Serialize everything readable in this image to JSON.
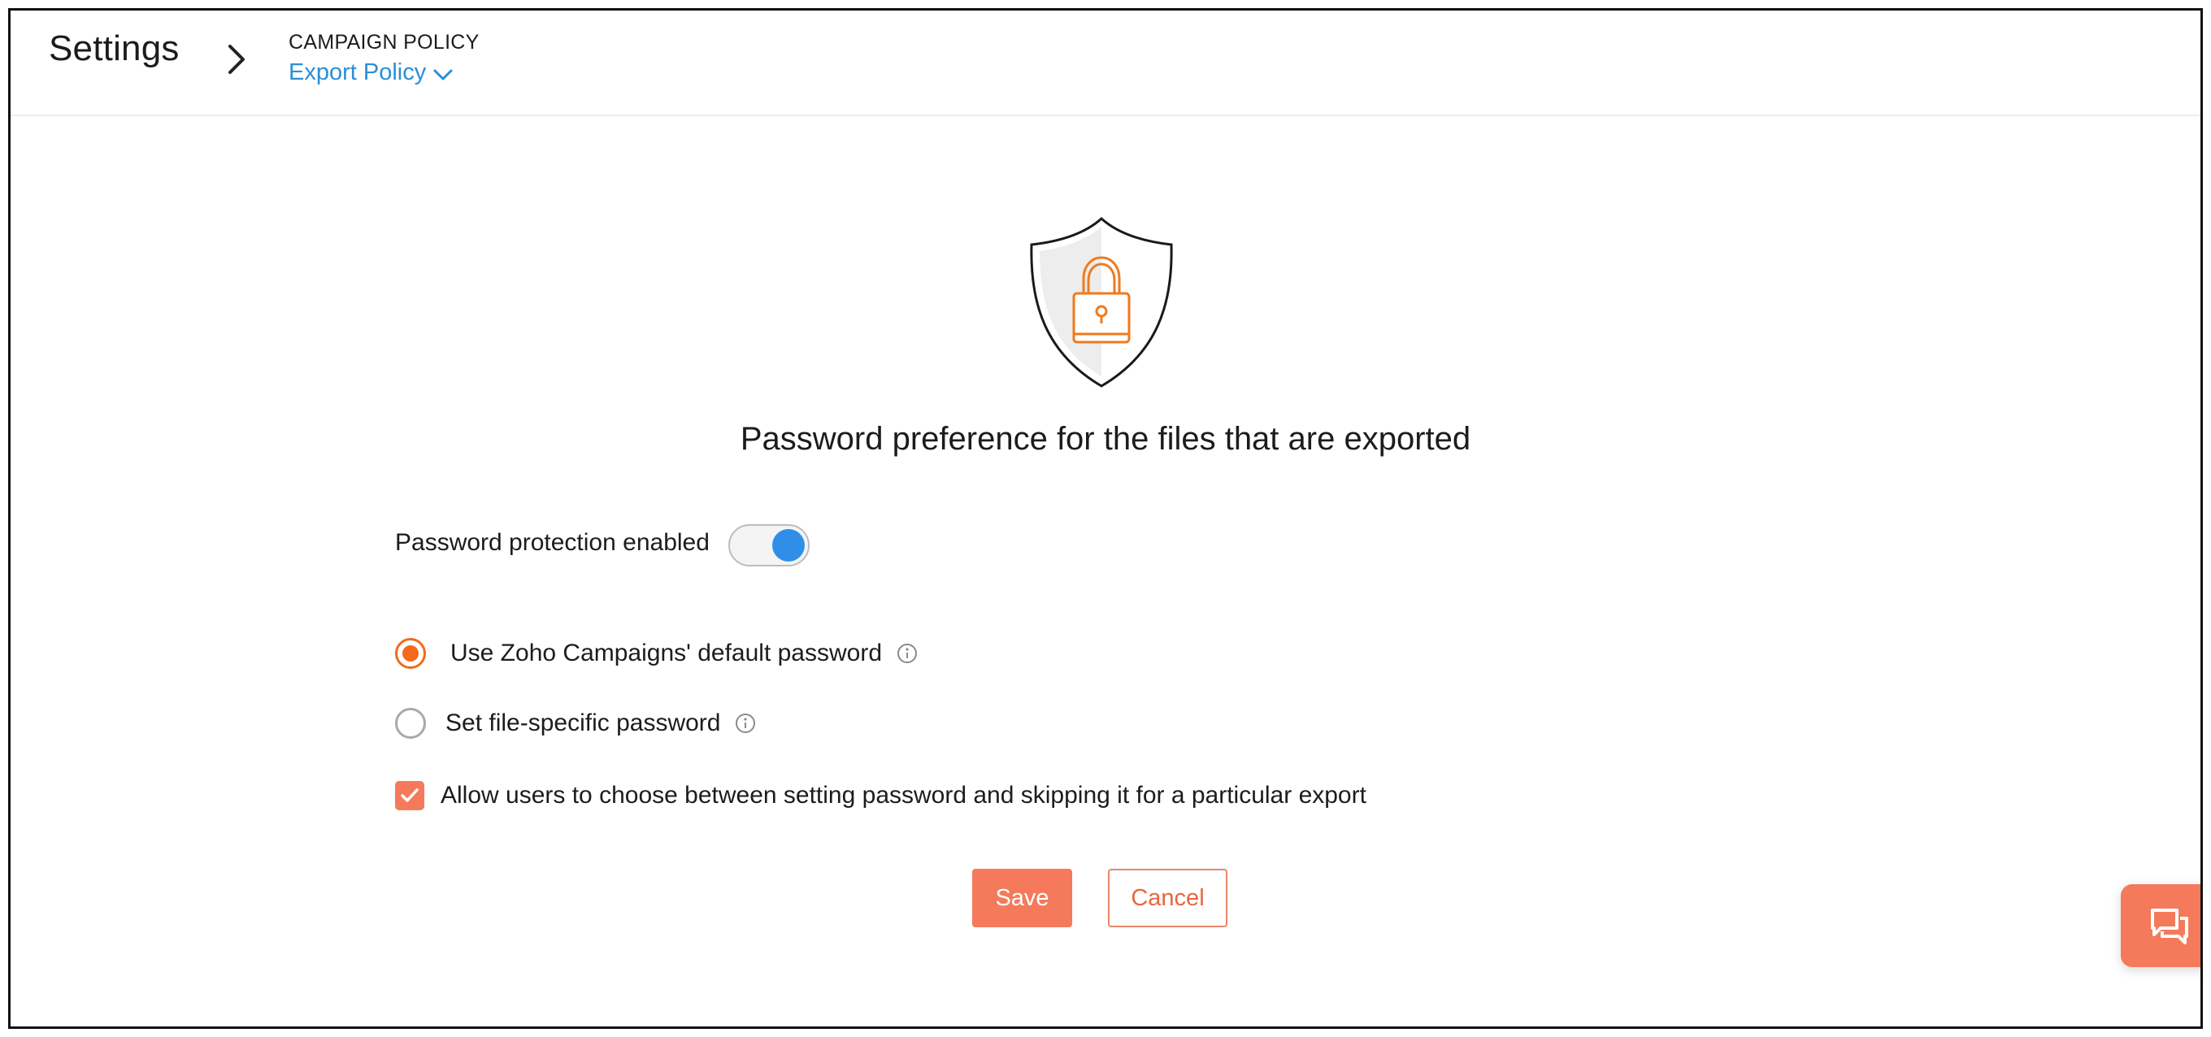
{
  "header": {
    "title": "Settings",
    "breadcrumb_parent": "CAMPAIGN POLICY",
    "breadcrumb_current": "Export Policy"
  },
  "main": {
    "heading": "Password preference for the files that are exported",
    "toggle": {
      "label": "Password protection enabled",
      "enabled": true
    },
    "options": [
      {
        "label": "Use Zoho Campaigns' default password",
        "selected": true
      },
      {
        "label": "Set file-specific password",
        "selected": false
      }
    ],
    "checkbox": {
      "label": "Allow users to choose between setting password and skipping it for a particular export",
      "checked": true
    },
    "buttons": {
      "save": "Save",
      "cancel": "Cancel"
    }
  },
  "colors": {
    "accent": "#f47a5b",
    "radio_selected": "#f26a1b",
    "toggle_on": "#2f8fe8",
    "link": "#2a8fd6"
  },
  "icons": {
    "breadcrumb_separator": "chevron-right-icon",
    "dropdown": "chevron-down-icon",
    "illustration": "shield-lock-icon",
    "info": "info-icon",
    "chat": "chat-icon"
  }
}
